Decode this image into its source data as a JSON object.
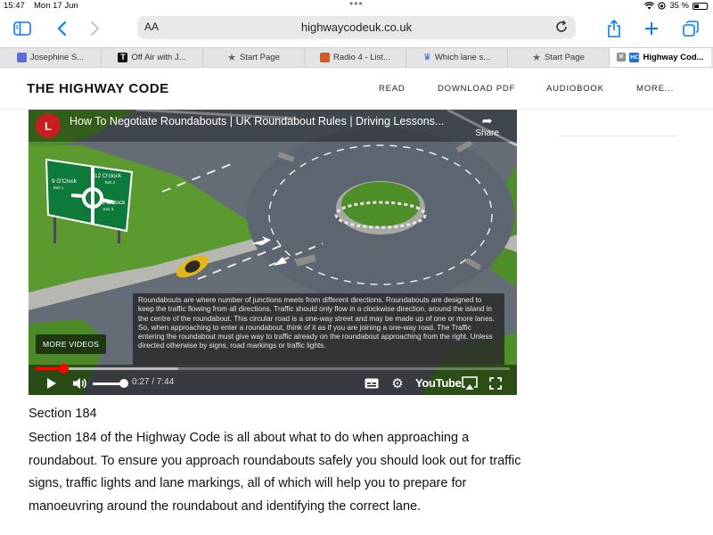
{
  "status_bar": {
    "time": "15:47",
    "date": "Mon 17 Jun",
    "battery_text": "35 %"
  },
  "toolbar": {
    "text_size_label": "AA",
    "url": "highwaycodeuk.co.uk",
    "accent_color": "#0a7aff"
  },
  "tabs": [
    {
      "title": "Josephine S...",
      "favicon_color": "#5b6ee1",
      "active": false
    },
    {
      "title": "Off Air with J...",
      "favicon_color": "#111111",
      "favicon_text": "T",
      "active": false
    },
    {
      "title": "Start Page",
      "favicon_icon": "star-icon",
      "active": false
    },
    {
      "title": "Radio 4 - List...",
      "favicon_color": "#e0561c",
      "active": false
    },
    {
      "title": "Which lane s...",
      "favicon_icon": "crown-icon",
      "active": false
    },
    {
      "title": "Start Page",
      "favicon_icon": "star-icon",
      "active": false
    },
    {
      "title": "Highway Cod...",
      "favicon_color": "#1e6fd8",
      "favicon_text": "HC",
      "active": true
    }
  ],
  "site": {
    "brand": "THE HIGHWAY CODE",
    "nav": [
      "READ",
      "DOWNLOAD PDF",
      "AUDIOBOOK",
      "MORE..."
    ]
  },
  "video": {
    "title": "How To Negotiate Roundabouts | UK Roundabout Rules | Driving Lessons...",
    "channel_logo_text": "L",
    "share_label": "Share",
    "more_videos_label": "MORE VIDEOS",
    "caption": "Roundabouts are where number of junctions meets from different directions. Roundabouts are designed to keep the traffic flowing from all directions. Traffic should only flow in a clockwise direction, around the island in the centre of the roundabout. This circular road is a one-way street and may be made up of one or more lanes. So, when approaching to enter a roundabout, think of it as if you are joining a one-way road. The Traffic entering the roundabout must give way to traffic already on the roundabout approaching from the right. Unless directed otherwise by signs, road markings or traffic lights.",
    "time_display": "0:27 / 7:44",
    "played_fraction": 0.058,
    "youtube_label": "YouTube",
    "sign": {
      "left": "9 O'Clock",
      "left_sub": "Exit 1",
      "top": "12 O'clock",
      "top_sub": "Exit 2",
      "right": "3 O'clock",
      "right_sub": "Exit 3"
    }
  },
  "article": {
    "heading": "Section 184",
    "body": "Section 184 of the Highway Code is all about what to do when approaching a roundabout. To ensure you approach roundabouts safely you should look out for traffic signs, traffic lights and lane markings, all of which will help you to prepare for manoeuvring around the roundabout and identifying the correct lane."
  }
}
